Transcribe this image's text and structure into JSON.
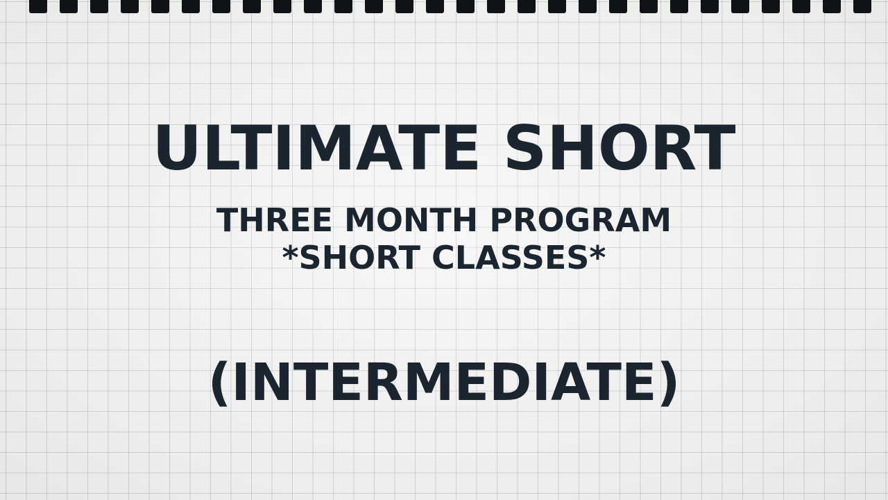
{
  "colors": {
    "text": "#1a2530",
    "paper": "#f5f5f3",
    "grid_line": "#5a646e",
    "binding_hole": "#101316"
  },
  "binding": {
    "icon": "spiral-binding-holes"
  },
  "cover": {
    "title": "ULTIMATE SHORT",
    "subtitle_line1": "THREE MONTH PROGRAM",
    "subtitle_line2": "*SHORT CLASSES*",
    "level": "(INTERMEDIATE)"
  }
}
